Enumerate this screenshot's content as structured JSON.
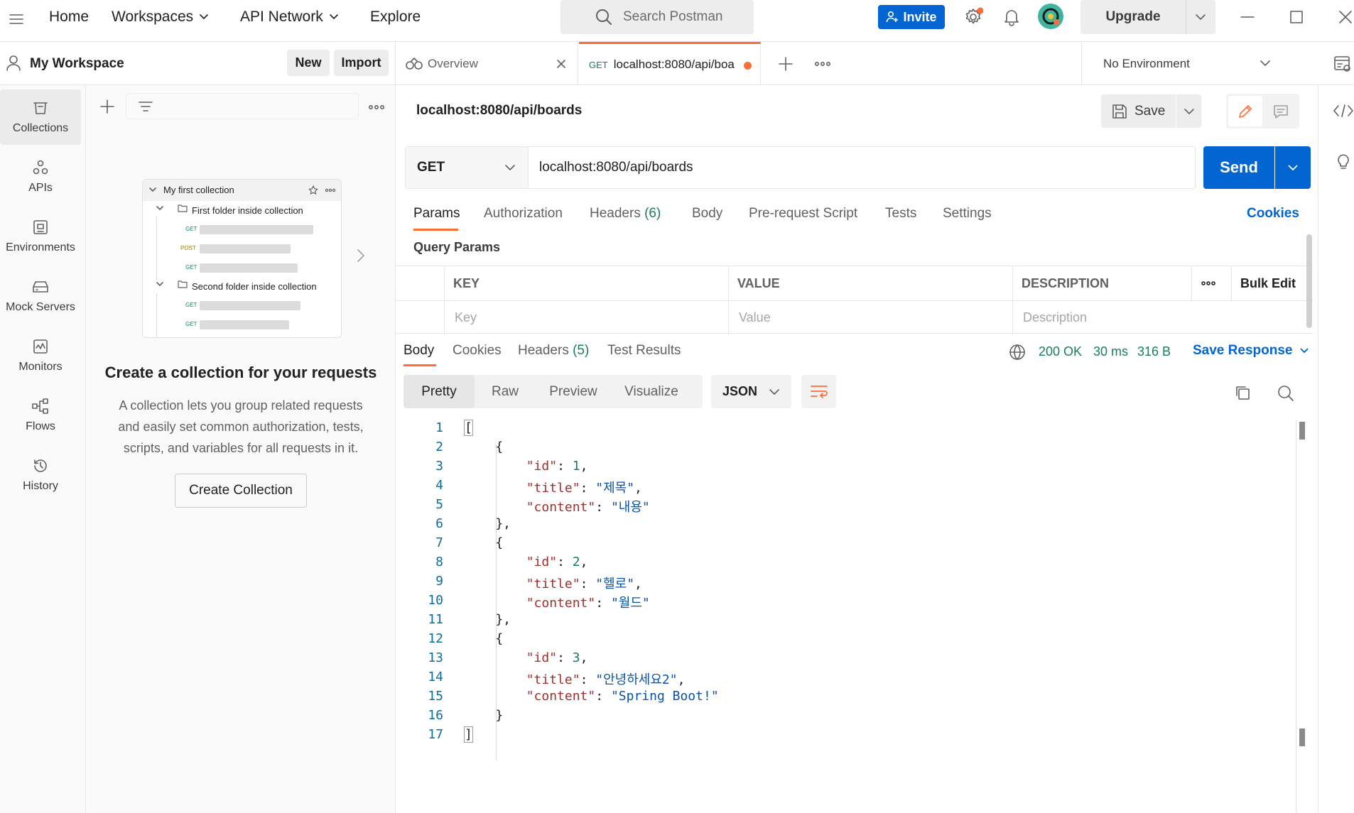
{
  "topbar": {
    "home": "Home",
    "workspaces": "Workspaces",
    "api_network": "API Network",
    "explore": "Explore",
    "search_placeholder": "Search Postman",
    "invite": "Invite",
    "upgrade": "Upgrade"
  },
  "workspace": {
    "name": "My Workspace",
    "new": "New",
    "import": "Import"
  },
  "rail": [
    {
      "label": "Collections",
      "icon": "collections-icon"
    },
    {
      "label": "APIs",
      "icon": "apis-icon"
    },
    {
      "label": "Environments",
      "icon": "environments-icon"
    },
    {
      "label": "Mock Servers",
      "icon": "mock-servers-icon"
    },
    {
      "label": "Monitors",
      "icon": "monitors-icon"
    },
    {
      "label": "Flows",
      "icon": "flows-icon"
    },
    {
      "label": "History",
      "icon": "history-icon"
    }
  ],
  "collections_empty": {
    "preview": {
      "collection": "My first collection",
      "folder1": "First folder inside collection",
      "folder2": "Second folder inside collection",
      "get": "GET",
      "post": "POST"
    },
    "title": "Create a collection for your requests",
    "desc_line1": "A collection lets you group related requests",
    "desc_line2": "and easily set common authorization, tests,",
    "desc_line3": "scripts, and variables for all requests in it.",
    "button": "Create Collection"
  },
  "tabs": {
    "overview": "Overview",
    "request_method": "GET",
    "request_title": "localhost:8080/api/boa",
    "environment": "No Environment"
  },
  "request": {
    "name": "localhost:8080/api/boards",
    "save": "Save",
    "method": "GET",
    "url": "localhost:8080/api/boards",
    "send": "Send",
    "tabs": [
      "Params",
      "Authorization",
      "Headers",
      "Body",
      "Pre-request Script",
      "Tests",
      "Settings"
    ],
    "headers_count": "(6)",
    "cookies": "Cookies",
    "query_params": "Query Params",
    "table": {
      "key": "KEY",
      "value": "VALUE",
      "description": "DESCRIPTION",
      "bulk_edit": "Bulk Edit",
      "key_ph": "Key",
      "value_ph": "Value",
      "description_ph": "Description"
    }
  },
  "response": {
    "tabs": [
      "Body",
      "Cookies",
      "Headers",
      "Test Results"
    ],
    "headers_count": "(5)",
    "status": "200 OK",
    "time": "30 ms",
    "size": "316 B",
    "save_response": "Save Response",
    "views": [
      "Pretty",
      "Raw",
      "Preview",
      "Visualize"
    ],
    "format": "JSON",
    "items": [
      {
        "id": "1",
        "title": "\"제목\"",
        "content": "\"내용\""
      },
      {
        "id": "2",
        "title": "\"헬로\"",
        "content": "\"월드\""
      },
      {
        "id": "3",
        "title": "\"안녕하세요2\"",
        "content": "\"Spring Boot!\""
      }
    ]
  },
  "colors": {
    "accent_orange": "#ff6c37",
    "send_blue": "#0265d2",
    "status_green": "#1a7f57"
  }
}
